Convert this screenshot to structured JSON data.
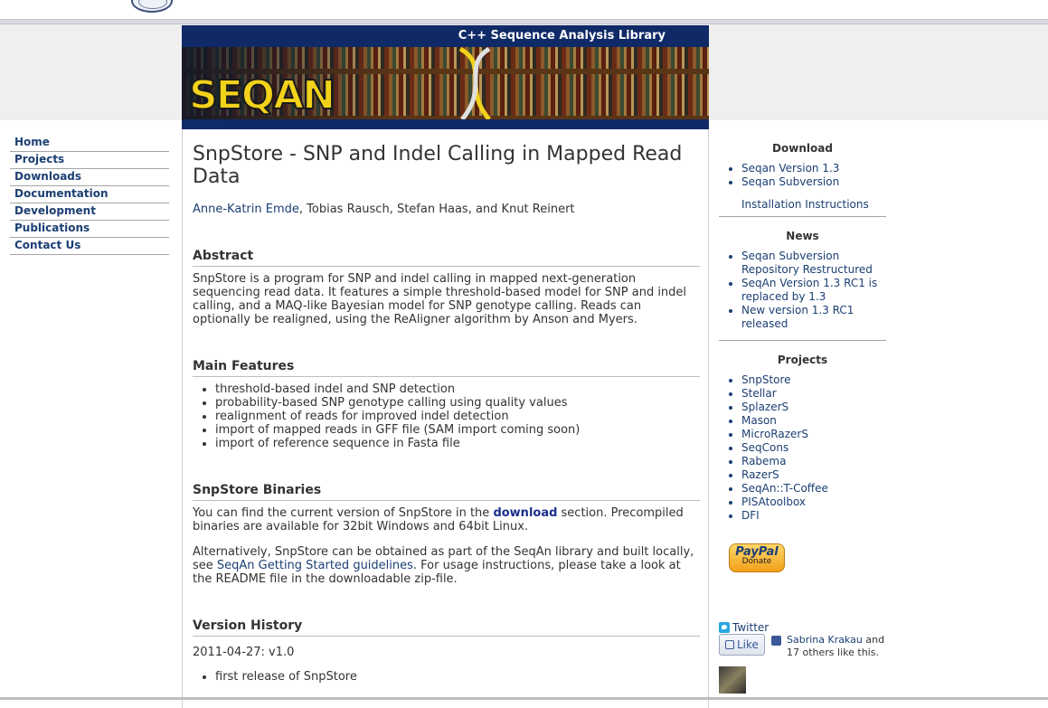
{
  "banner": {
    "tagline": "C++ Sequence Analysis Library",
    "logo_text": "SEQAN"
  },
  "nav": [
    {
      "label": "Home"
    },
    {
      "label": "Projects"
    },
    {
      "label": "Downloads"
    },
    {
      "label": "Documentation"
    },
    {
      "label": "Development"
    },
    {
      "label": "Publications"
    },
    {
      "label": "Contact Us"
    }
  ],
  "main": {
    "title": "SnpStore - SNP and Indel Calling in Mapped Read Data",
    "author_link": "Anne-Katrin Emde",
    "authors_rest": ", Tobias Rausch, Stefan Haas, and Knut Reinert",
    "abstract": {
      "heading": "Abstract",
      "text": "SnpStore is a program for SNP and indel calling in mapped next-generation sequencing read data. It features a simple threshold-based model for SNP and indel calling, and a MAQ-like Bayesian model for SNP genotype calling. Reads can optionally be realigned, using the ReAligner algorithm by Anson and Myers."
    },
    "features": {
      "heading": "Main Features",
      "items": [
        "threshold-based indel and SNP detection",
        "probability-based SNP genotype calling using quality values",
        "realignment of reads for improved indel detection",
        "import of mapped reads in GFF file (SAM import coming soon)",
        "import of reference sequence in Fasta file"
      ]
    },
    "binaries": {
      "heading": "SnpStore Binaries",
      "p1_before": "You can find the current version of SnpStore in the ",
      "p1_link": "download",
      "p1_after": " section. Precompiled binaries are available for 32bit Windows and 64bit Linux.",
      "p2_before": "Alternatively, SnpStore can be obtained as part of the SeqAn library and built locally, see ",
      "p2_link": "SeqAn Getting Started guidelines",
      "p2_after": ". For usage instructions, please take a look at the README file in the downloadable zip-file."
    },
    "history": {
      "heading": "Version History",
      "entry": "2011-04-27: v1.0",
      "items": [
        "first release of SnpStore"
      ]
    }
  },
  "sidebar": {
    "download": {
      "heading": "Download",
      "items": [
        "Seqan Version 1.3",
        "Seqan Subversion"
      ],
      "install": "Installation Instructions"
    },
    "news": {
      "heading": "News",
      "items": [
        "Seqan Subversion Repository Restructured",
        "SeqAn Version 1.3 RC1 is replaced by 1.3",
        "New version 1.3 RC1 released"
      ]
    },
    "projects": {
      "heading": "Projects",
      "items": [
        "SnpStore",
        "Stellar",
        "SplazerS",
        "Mason",
        "MicroRazerS",
        "SeqCons",
        "Rabema",
        "RazerS",
        "SeqAn::T-Coffee",
        "PISAtoolbox",
        "DFI"
      ]
    },
    "paypal": {
      "name": "PayPal",
      "donate": "Donate"
    },
    "twitter": "Twitter",
    "like": "Like",
    "fb_name": "Sabrina Krakau",
    "fb_rest": " and 17 others like this."
  }
}
